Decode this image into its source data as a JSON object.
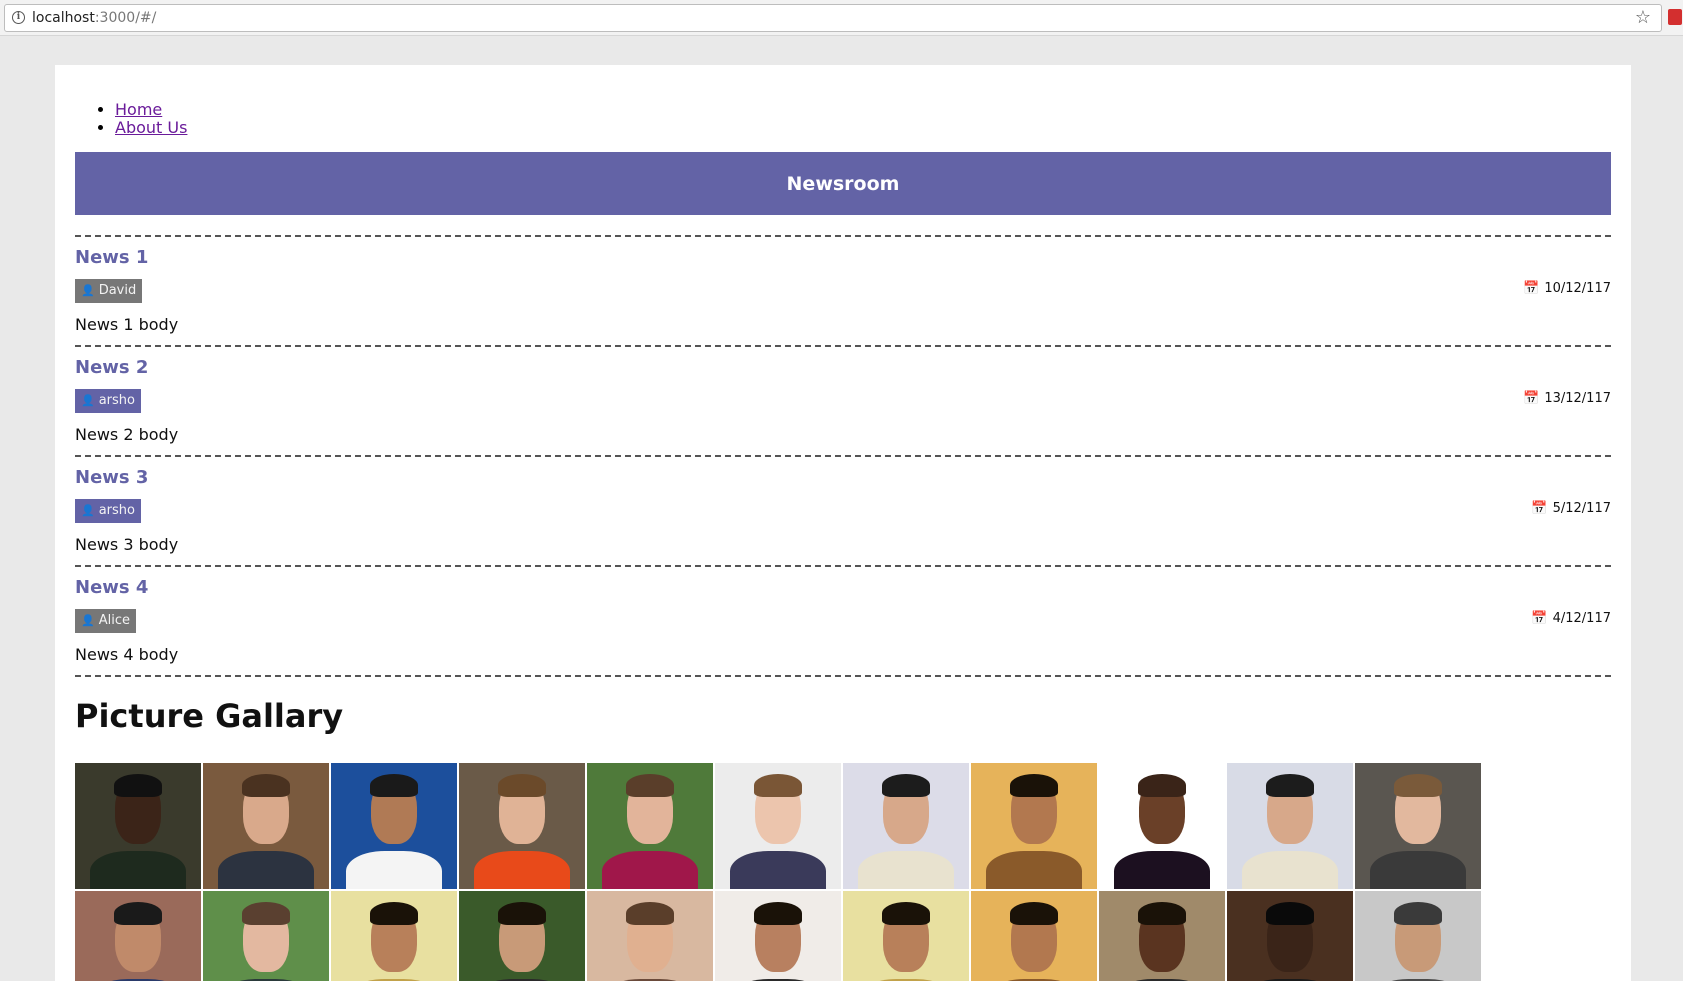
{
  "browser": {
    "url_host": "localhost",
    "url_rest": ":3000/#/"
  },
  "nav": [
    {
      "label": "Home"
    },
    {
      "label": "About Us"
    }
  ],
  "banner": {
    "title": "Newsroom"
  },
  "news": [
    {
      "title": "News 1",
      "author": "David",
      "author_color": "#777777",
      "date": "10/12/117",
      "body": "News 1 body"
    },
    {
      "title": "News 2",
      "author": "arsho",
      "author_color": "#6363a6",
      "date": "13/12/117",
      "body": "News 2 body"
    },
    {
      "title": "News 3",
      "author": "arsho",
      "author_color": "#6363a6",
      "date": "5/12/117",
      "body": "News 3 body"
    },
    {
      "title": "News 4",
      "author": "Alice",
      "author_color": "#777777",
      "date": "4/12/117",
      "body": "News 4 body"
    }
  ],
  "gallery": {
    "title": "Picture Gallary",
    "photos": [
      {
        "bg": "#3a3a2c",
        "skin": "#3b2418",
        "shirt": "#1e2a1e",
        "hair": "#111"
      },
      {
        "bg": "#7a5a3e",
        "skin": "#d9a98b",
        "shirt": "#2c3340",
        "hair": "#4a3220"
      },
      {
        "bg": "#1c4f9c",
        "skin": "#b07a55",
        "shirt": "#f4f4f4",
        "hair": "#1a1a1a"
      },
      {
        "bg": "#6a5a48",
        "skin": "#e0b396",
        "shirt": "#e84a1a",
        "hair": "#6b4a2a"
      },
      {
        "bg": "#4f7a3a",
        "skin": "#e2b49a",
        "shirt": "#a0174a",
        "hair": "#5a3e2a"
      },
      {
        "bg": "#ececec",
        "skin": "#ecc5ad",
        "shirt": "#3a3a5a",
        "hair": "#7a5636"
      },
      {
        "bg": "#dcdce8",
        "skin": "#d7a88a",
        "shirt": "#e8e2cf",
        "hair": "#1c1c1c"
      },
      {
        "bg": "#e6b35a",
        "skin": "#b2784f",
        "shirt": "#8a5a2a",
        "hair": "#1a1208"
      },
      {
        "bg": "#ffffff",
        "skin": "#6a4028",
        "shirt": "#1c1020",
        "hair": "#3a2418"
      },
      {
        "bg": "#d8dbe6",
        "skin": "#d7a88a",
        "shirt": "#e8e2cf",
        "hair": "#1c1c1c"
      },
      {
        "bg": "#5a5650",
        "skin": "#e2b89e",
        "shirt": "#3a3a3a",
        "hair": "#7a5a3a"
      },
      {
        "bg": "#9a6a5a",
        "skin": "#c08a6a",
        "shirt": "#2a3a6a",
        "hair": "#1a1a1a"
      },
      {
        "bg": "#5f8f4a",
        "skin": "#e3b8a0",
        "shirt": "#2a3a3a",
        "hair": "#5a4030"
      },
      {
        "bg": "#e8e0a0",
        "skin": "#b8805a",
        "shirt": "#c2a24a",
        "hair": "#1a1208"
      },
      {
        "bg": "#3a5a2a",
        "skin": "#c89a78",
        "shirt": "#2a2a2a",
        "hair": "#1a1208"
      },
      {
        "bg": "#d8b8a0",
        "skin": "#e0b090",
        "shirt": "#6a4a3a",
        "hair": "#5a3e2a"
      },
      {
        "bg": "#f0ece8",
        "skin": "#b88060",
        "shirt": "#2a2a2a",
        "hair": "#1a1208"
      },
      {
        "bg": "#e8e0a0",
        "skin": "#b8805a",
        "shirt": "#c2a24a",
        "hair": "#1a1208"
      },
      {
        "bg": "#e6b35a",
        "skin": "#b2784f",
        "shirt": "#8a5a2a",
        "hair": "#1a1208"
      },
      {
        "bg": "#a08a6a",
        "skin": "#5a3420",
        "shirt": "#2a2a2a",
        "hair": "#1a1208"
      },
      {
        "bg": "#4a3020",
        "skin": "#3a2418",
        "shirt": "#1a1a1a",
        "hair": "#0a0a0a"
      },
      {
        "bg": "#c8c8c8",
        "skin": "#c89a78",
        "shirt": "#4a4a4a",
        "hair": "#3a3a3a"
      }
    ]
  }
}
